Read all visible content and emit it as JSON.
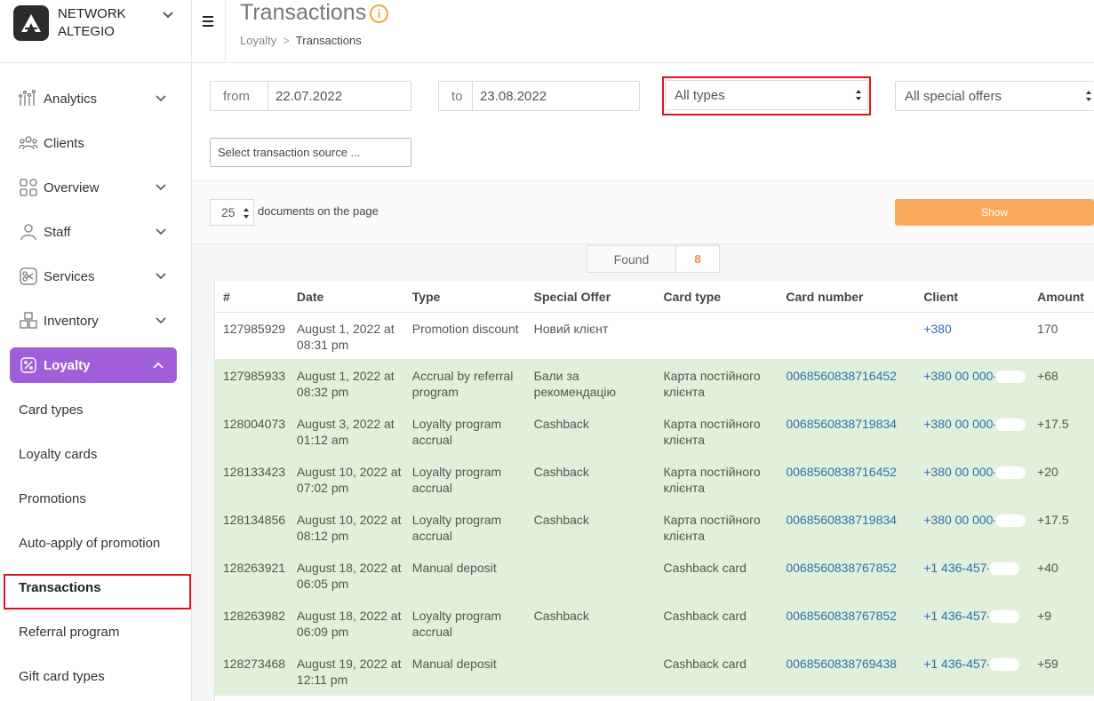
{
  "brand": {
    "line1": "NETWORK",
    "line2": "ALTEGIO"
  },
  "nav": {
    "analytics": "Analytics",
    "clients": "Clients",
    "overview": "Overview",
    "staff": "Staff",
    "services": "Services",
    "inventory": "Inventory",
    "loyalty": "Loyalty",
    "sub": {
      "card_types": "Card types",
      "loyalty_cards": "Loyalty cards",
      "promotions": "Promotions",
      "auto_apply": "Auto-apply of promotion",
      "transactions": "Transactions",
      "referral": "Referral program",
      "gift_card_types": "Gift card types"
    }
  },
  "header": {
    "title": "Transactions",
    "breadcrumb_parent": "Loyalty",
    "breadcrumb_sep": ">",
    "breadcrumb_current": "Transactions"
  },
  "filters": {
    "from_label": "from",
    "from_value": "22.07.2022",
    "to_label": "to",
    "to_value": "23.08.2022",
    "type_value": "All types",
    "offers_value": "All special offers",
    "source_placeholder": "Select transaction source ..."
  },
  "toolbar": {
    "per_page": "25",
    "per_page_label": "documents on the page",
    "show_label": "Show"
  },
  "found": {
    "label": "Found",
    "count": "8"
  },
  "table": {
    "headers": {
      "num": "#",
      "date": "Date",
      "type": "Type",
      "offer": "Special Offer",
      "card_type": "Card type",
      "card_number": "Card number",
      "client": "Client",
      "amount": "Amount"
    },
    "rows": [
      {
        "num": "127985929",
        "date": "August 1, 2022 at 08:31 pm",
        "type": "Promotion discount",
        "offer": "Новий клієнт",
        "card_type": "",
        "card_number": "",
        "client": "+380",
        "amount": "170"
      },
      {
        "num": "127985933",
        "date": "August 1, 2022 at 08:32 pm",
        "type": "Accrual by referral program",
        "offer": "Бали за рекомендацію",
        "card_type": "Карта постійного клієнта",
        "card_number": "0068560838716452",
        "client": "+380 00 000-",
        "amount": "+68"
      },
      {
        "num": "128004073",
        "date": "August 3, 2022 at 01:12 am",
        "type": "Loyalty program accrual",
        "offer": "Cashback",
        "card_type": "Карта постійного клієнта",
        "card_number": "0068560838719834",
        "client": "+380 00 000-",
        "amount": "+17.5"
      },
      {
        "num": "128133423",
        "date": "August 10, 2022 at 07:02 pm",
        "type": "Loyalty program accrual",
        "offer": "Cashback",
        "card_type": "Карта постійного клієнта",
        "card_number": "0068560838716452",
        "client": "+380 00 000-",
        "amount": "+20"
      },
      {
        "num": "128134856",
        "date": "August 10, 2022 at 08:12 pm",
        "type": "Loyalty program accrual",
        "offer": "Cashback",
        "card_type": "Карта постійного клієнта",
        "card_number": "0068560838719834",
        "client": "+380 00 000-",
        "amount": "+17.5"
      },
      {
        "num": "128263921",
        "date": "August 18, 2022 at 06:05 pm",
        "type": "Manual deposit",
        "offer": "",
        "card_type": "Cashback card",
        "card_number": "0068560838767852",
        "client": "+1 436-457-",
        "amount": "+40"
      },
      {
        "num": "128263982",
        "date": "August 18, 2022 at 06:09 pm",
        "type": "Loyalty program accrual",
        "offer": "Cashback",
        "card_type": "Cashback card",
        "card_number": "0068560838767852",
        "client": "+1 436-457-",
        "amount": "+9"
      },
      {
        "num": "128273468",
        "date": "August 19, 2022 at 12:11 pm",
        "type": "Manual deposit",
        "offer": "",
        "card_type": "Cashback card",
        "card_number": "0068560838769438",
        "client": "+1 436-457-",
        "amount": "+59"
      }
    ]
  },
  "colors": {
    "accent": "#a15ed9",
    "show_button": "#f8a95a",
    "highlight_row": "#e0f0da",
    "annotation": "#e0141e",
    "link": "#2f6fb0"
  }
}
